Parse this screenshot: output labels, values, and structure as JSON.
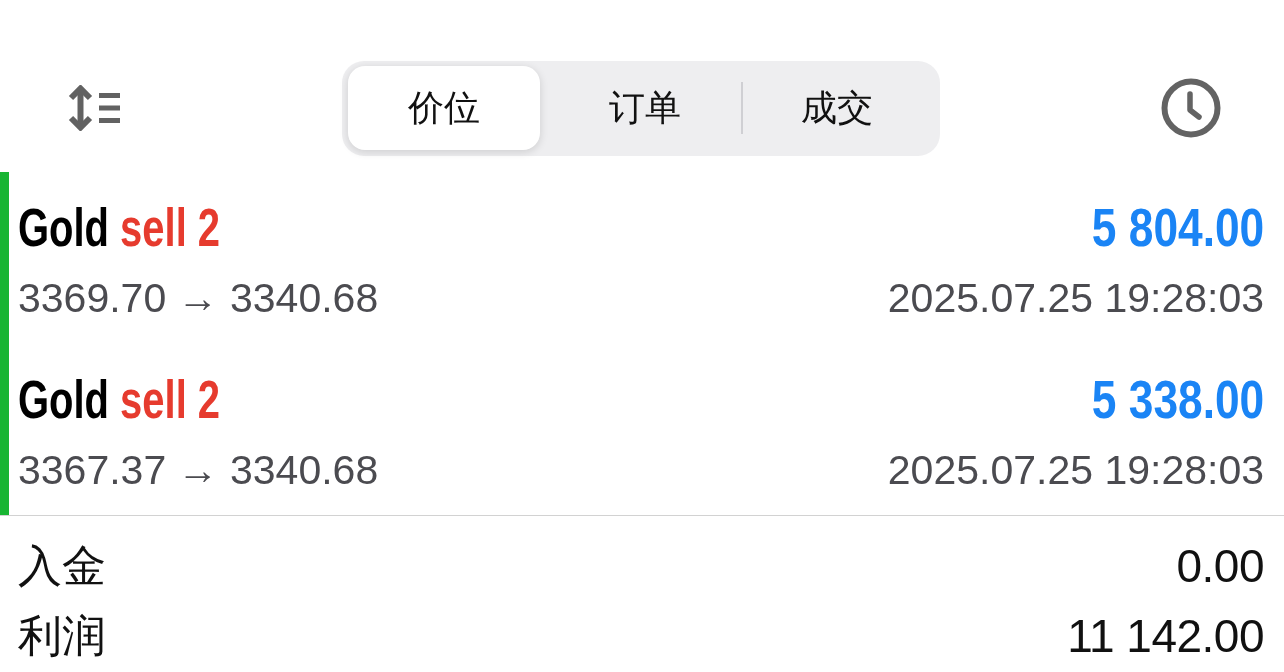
{
  "toolbar": {
    "tabs": [
      {
        "label": "价位",
        "selected": true
      },
      {
        "label": "订单",
        "selected": false
      },
      {
        "label": "成交",
        "selected": false
      }
    ]
  },
  "deals": [
    {
      "symbol": "Gold",
      "action": "sell 2",
      "color": "#e63b2e",
      "highlighted": true,
      "profit": "5 804.00",
      "prices": "3369.70 → 3340.68",
      "time": "2025.07.25 19:28:03"
    },
    {
      "symbol": "Gold",
      "action": "sell 2",
      "color": "#e63b2e",
      "highlighted": true,
      "profit": "5 338.00",
      "prices": "3367.37 → 3340.68",
      "time": "2025.07.25 19:28:03"
    }
  ],
  "summary": [
    {
      "label": "入金",
      "value": "0.00"
    },
    {
      "label": "利润",
      "value": "11 142.00"
    }
  ]
}
